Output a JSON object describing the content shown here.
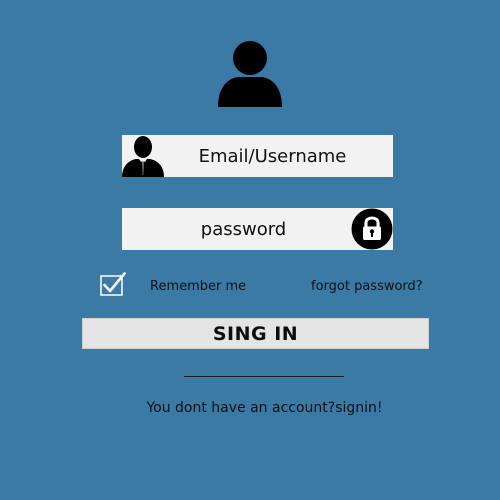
{
  "form": {
    "avatar_icon": "user-avatar-icon",
    "email": {
      "placeholder": "Email/Username",
      "value": "",
      "icon": "businessman-icon"
    },
    "password": {
      "placeholder": "password",
      "value": "",
      "icon": "lock-icon"
    },
    "remember": {
      "label": "Remember me",
      "checked": true
    },
    "forgot_label": "forgot password?",
    "submit_label": "SING IN",
    "account_prompt": "You dont have an account?signin!"
  },
  "colors": {
    "background": "#3b7aa5",
    "field_background": "#f3f2f2",
    "button_background": "#e4e4e4",
    "icon_color": "#000000"
  }
}
